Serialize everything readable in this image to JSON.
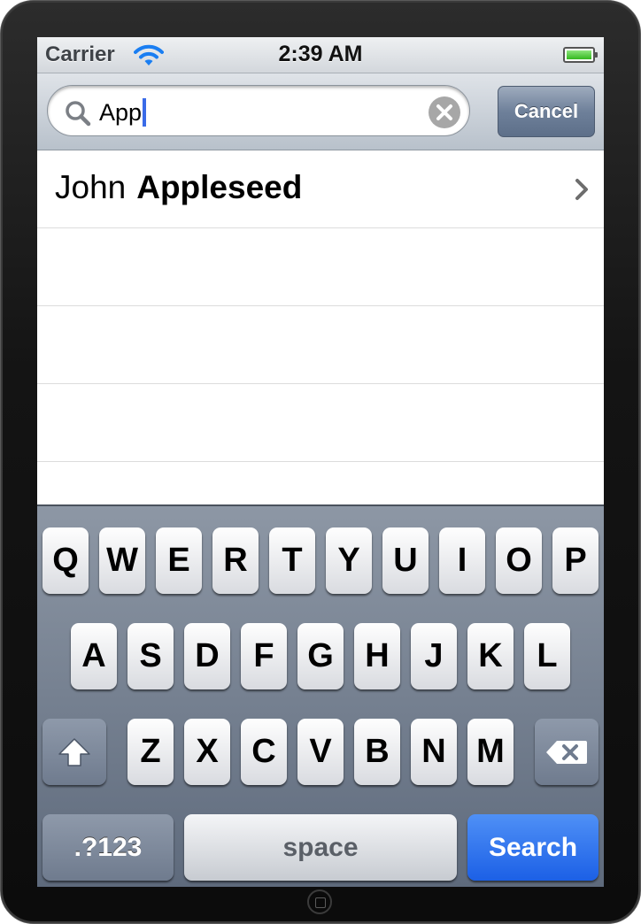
{
  "status_bar": {
    "carrier": "Carrier",
    "time": "2:39 AM"
  },
  "search": {
    "query": "App",
    "cancel_label": "Cancel"
  },
  "results": [
    {
      "first_name": "John",
      "last_name": "Appleseed"
    }
  ],
  "keyboard": {
    "row1": [
      "Q",
      "W",
      "E",
      "R",
      "T",
      "Y",
      "U",
      "I",
      "O",
      "P"
    ],
    "row2": [
      "A",
      "S",
      "D",
      "F",
      "G",
      "H",
      "J",
      "K",
      "L"
    ],
    "row3": [
      "Z",
      "X",
      "C",
      "V",
      "B",
      "N",
      "M"
    ],
    "numbers_label": ".?123",
    "space_label": "space",
    "search_label": "Search"
  },
  "icons": {
    "wifi": "wifi-icon",
    "battery": "battery-icon",
    "search": "search-icon",
    "clear": "clear-icon",
    "chevron": "chevron-right-icon",
    "shift": "shift-icon",
    "delete": "delete-icon"
  },
  "colors": {
    "accent": "#1c60e6",
    "caret": "#3a6be8",
    "battery": "#34b81f"
  }
}
